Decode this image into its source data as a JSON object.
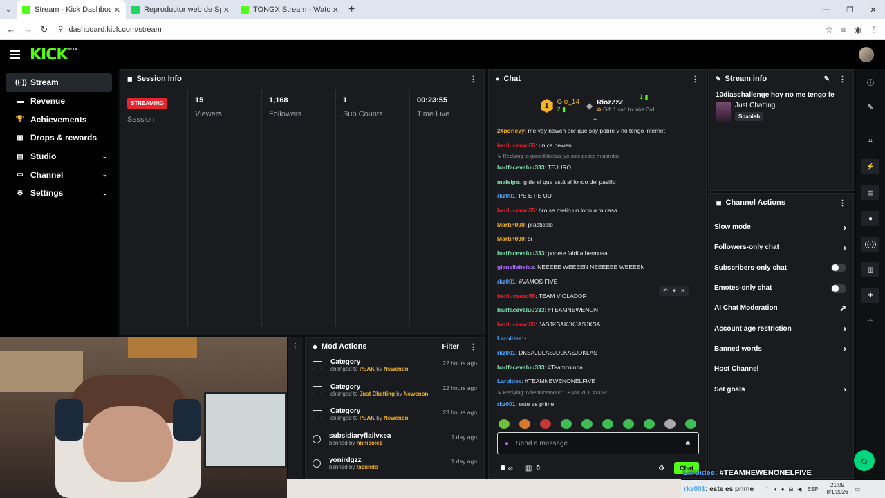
{
  "browser": {
    "tabs": [
      {
        "title": "Stream - Kick Dashboard",
        "active": true,
        "fav_color": "#53fc18"
      },
      {
        "title": "Reproductor web de Spotify: m",
        "active": false,
        "fav_color": "#1ed760"
      },
      {
        "title": "TONGX Stream - Watch Live on",
        "active": false,
        "fav_color": "#53fc18"
      }
    ],
    "url": "dashboard.kick.com/stream"
  },
  "brand": {
    "logo": "KICK",
    "beta": "BETA",
    "accent": "#53fc18"
  },
  "sidebar": {
    "items": [
      {
        "label": "Stream",
        "icon": "broadcast-icon",
        "glyph": "((·))",
        "active": true,
        "expand": false
      },
      {
        "label": "Revenue",
        "icon": "wallet-icon",
        "glyph": "▬",
        "active": false,
        "expand": false
      },
      {
        "label": "Achievements",
        "icon": "trophy-icon",
        "glyph": "🏆",
        "active": false,
        "expand": false
      },
      {
        "label": "Drops & rewards",
        "icon": "gift-icon",
        "glyph": "▣",
        "active": false,
        "expand": false
      },
      {
        "label": "Studio",
        "icon": "studio-icon",
        "glyph": "▤",
        "active": false,
        "expand": true
      },
      {
        "label": "Channel",
        "icon": "channel-icon",
        "glyph": "▭",
        "active": false,
        "expand": true
      },
      {
        "label": "Settings",
        "icon": "gear-icon",
        "glyph": "⚙",
        "active": false,
        "expand": true
      }
    ]
  },
  "session": {
    "title": "Session Info",
    "status": "STREAMING",
    "status_label": "Session",
    "stats": [
      {
        "value": "15",
        "label": "Viewers"
      },
      {
        "value": "1,168",
        "label": "Followers"
      },
      {
        "value": "1",
        "label": "Sub Counts"
      },
      {
        "value": "00:23:55",
        "label": "Time Live"
      }
    ]
  },
  "chat": {
    "title": "Chat",
    "top": {
      "left_name": "Gio_14",
      "left_count": "2",
      "right_name": "RiozZzZ",
      "right_count": "1",
      "gift_text": "Gift 1 sub to take 3rd"
    },
    "messages": [
      {
        "user": "24porleyy",
        "color": "#f2b327",
        "text": "me voy newen por qué soy pobre y no tengo internet"
      },
      {
        "user": "benluceroo55",
        "color": "#e3262f",
        "text": "un cs newen"
      },
      {
        "reply": "Replying to gianellabelaa: yo solo pesco mojarritas"
      },
      {
        "user": "badfacevaluu333",
        "color": "#7fe3b0",
        "text": "TEJURO"
      },
      {
        "user": "maleipa",
        "color": "#7fe3b0",
        "text": "ig de el que está al fondo del pasillo"
      },
      {
        "user": "rkz001",
        "color": "#4da3ff",
        "text": "PE E PE UU"
      },
      {
        "user": "benluceroo55",
        "color": "#e3262f",
        "text": "bro se metio un lobo a tu casa"
      },
      {
        "user": "Martin090",
        "color": "#f2b327",
        "text": "practicalo"
      },
      {
        "user": "Martin090",
        "color": "#f2b327",
        "text": "si"
      },
      {
        "user": "badfacevaluu333",
        "color": "#7fe3b0",
        "text": "ponete faldita,hermosa"
      },
      {
        "user": "gianellabelaa",
        "color": "#b36bff",
        "text": "NEEEEE WEEEEN NEEEEEE WEEEEN"
      },
      {
        "user": "rkz001",
        "color": "#4da3ff",
        "text": "#VAMOS FIVE"
      },
      {
        "user": "benluceroo55",
        "color": "#e3262f",
        "text": "TEAM VIOLADOR"
      },
      {
        "user": "badfacevaluu333",
        "color": "#7fe3b0",
        "text": "#TEAMNEWENON"
      },
      {
        "user": "benluceroo55",
        "color": "#e3262f",
        "text": "JASJKSAKJKJASJKSA"
      },
      {
        "user": "Laroidee",
        "color": "#4da3ff",
        "text": "·"
      },
      {
        "user": "rkz001",
        "color": "#4da3ff",
        "text": "DKSAJDLASJDLKASJDKLAS"
      },
      {
        "user": "badfacevaluu333",
        "color": "#7fe3b0",
        "text": "#Teamculona"
      },
      {
        "user": "Laroidee",
        "color": "#4da3ff",
        "text": "#TEAMNEWENONELFIVE"
      },
      {
        "reply": "Replying to benluceroo55: TEAM VIOLADOR"
      },
      {
        "user": "rkz001",
        "color": "#4da3ff",
        "text": "este es prime"
      }
    ],
    "input_placeholder": "Send a message",
    "viewer_count": "0",
    "send_label": "Chat"
  },
  "stream_info": {
    "title": "Stream info",
    "stream_title": "10diaschallenge hoy no me tengo fe",
    "category": "Just Chatting",
    "language": "Spanish"
  },
  "channel_actions": {
    "title": "Channel Actions",
    "items": [
      {
        "label": "Slow mode",
        "control": "chevron"
      },
      {
        "label": "Followers-only chat",
        "control": "chevron"
      },
      {
        "label": "Subscribers-only chat",
        "control": "toggle"
      },
      {
        "label": "Emotes-only chat",
        "control": "toggle"
      },
      {
        "label": "AI Chat Moderation",
        "control": "external"
      },
      {
        "label": "Account age restriction",
        "control": "chevron"
      },
      {
        "label": "Banned words",
        "control": "chevron"
      },
      {
        "label": "Host Channel",
        "control": "none"
      },
      {
        "label": "Set goals",
        "control": "chevron"
      }
    ]
  },
  "mod_actions": {
    "title": "Mod Actions",
    "filter_label": "Filter",
    "rows": [
      {
        "title": "Category",
        "pre": "changed to",
        "target": "PEAK",
        "by": "by",
        "mod": "Newenon",
        "time": "22 hours ago",
        "icon": "category-icon"
      },
      {
        "title": "Category",
        "pre": "changed to",
        "target": "Just Chatting",
        "by": "by",
        "mod": "Newenon",
        "time": "22 hours ago",
        "icon": "category-icon"
      },
      {
        "title": "Category",
        "pre": "changed to",
        "target": "PEAK",
        "by": "by",
        "mod": "Newenon",
        "time": "23 hours ago",
        "icon": "category-icon"
      },
      {
        "title": "subsidiaryflailvxea",
        "pre": "banned by",
        "target": "",
        "by": "",
        "mod": "nnnicole1",
        "time": "1 day ago",
        "icon": "ban-icon"
      },
      {
        "title": "yonirdgzz",
        "pre": "banned by",
        "target": "",
        "by": "",
        "mod": "facundo",
        "time": "1 day ago",
        "icon": "ban-icon"
      }
    ]
  },
  "overlay": {
    "line1_user": "Laroidee",
    "line1_text": ": #TEAMNEWENONELFIVE",
    "line2_user": "rkz001",
    "line2_text": ": este es prime"
  },
  "taskbar": {
    "lang": "ESP",
    "time": "21:09",
    "date": "8/1/2026"
  }
}
